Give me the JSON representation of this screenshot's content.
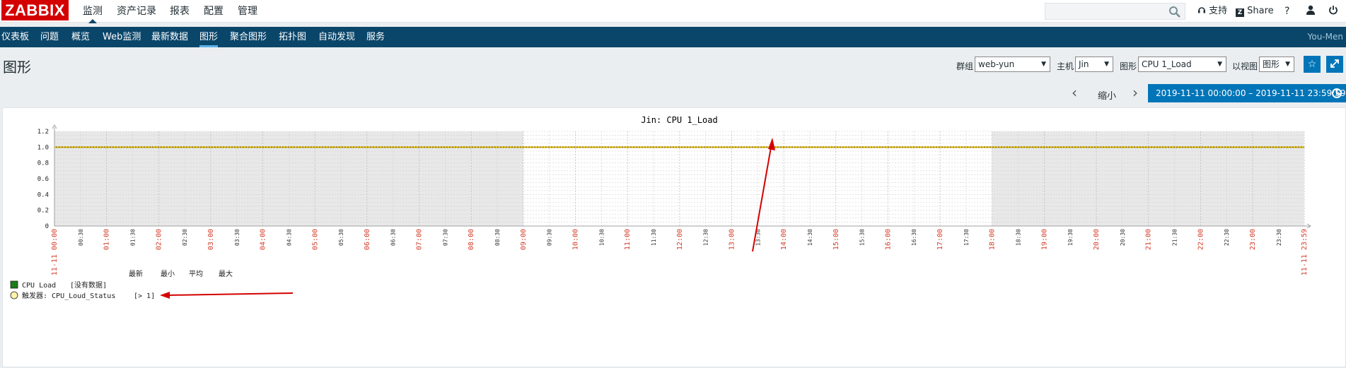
{
  "app": {
    "logo_text": "ZABBIX",
    "top_menu": [
      {
        "label": "监测",
        "active": true
      },
      {
        "label": "资产记录",
        "active": false
      },
      {
        "label": "报表",
        "active": false
      },
      {
        "label": "配置",
        "active": false
      },
      {
        "label": "管理",
        "active": false
      }
    ],
    "support_label": "支持",
    "share_label": "Share",
    "help_label": "?",
    "username": "You-Men"
  },
  "nav": {
    "items": [
      {
        "label": "仪表板",
        "active": false
      },
      {
        "label": "问题",
        "active": false
      },
      {
        "label": "概览",
        "active": false
      },
      {
        "label": "Web监测",
        "active": false
      },
      {
        "label": "最新数据",
        "active": false
      },
      {
        "label": "图形",
        "active": true
      },
      {
        "label": "聚合图形",
        "active": false
      },
      {
        "label": "拓扑图",
        "active": false
      },
      {
        "label": "自动发现",
        "active": false
      },
      {
        "label": "服务",
        "active": false
      }
    ]
  },
  "page": {
    "title": "图形",
    "filters": {
      "group_label": "群组",
      "group_value": "web-yun",
      "host_label": "主机",
      "host_value": "Jin",
      "graph_label": "图形",
      "graph_value": "CPU 1_Load",
      "view_label": "以视图",
      "view_value": "图形"
    },
    "time": {
      "zoom_out": "缩小",
      "range": "2019-11-11 00:00:00 – 2019-11-11 23:59:59"
    }
  },
  "chart_data": {
    "type": "line",
    "title": "Jin: CPU 1_Load",
    "ylim": [
      0,
      1.2
    ],
    "y_ticks": [
      "0",
      "0.2",
      "0.4",
      "0.6",
      "0.8",
      "1.0",
      "1.2"
    ],
    "x_tick_labels": [
      "11-11 00:00",
      "00:30",
      "01:00",
      "01:30",
      "02:00",
      "02:30",
      "03:00",
      "03:30",
      "04:00",
      "04:30",
      "05:00",
      "05:30",
      "06:00",
      "06:30",
      "07:00",
      "07:30",
      "08:00",
      "08:30",
      "09:00",
      "09:30",
      "10:00",
      "10:30",
      "11:00",
      "11:30",
      "12:00",
      "12:30",
      "13:00",
      "13:30",
      "14:00",
      "14:30",
      "15:00",
      "15:30",
      "16:00",
      "16:30",
      "17:00",
      "17:30",
      "18:00",
      "18:30",
      "19:00",
      "19:30",
      "20:00",
      "20:30",
      "21:00",
      "21:30",
      "22:00",
      "22:30",
      "23:00",
      "23:30",
      "11-11 23:59"
    ],
    "grid": true,
    "shaded_periods": [
      [
        "00:00",
        "09:00"
      ],
      [
        "18:00",
        "23:59"
      ]
    ],
    "series": [
      {
        "name": "CPU Load",
        "values": [],
        "color": "#1a7c1a"
      }
    ],
    "trigger": {
      "name": "CPU_Loud_Status",
      "threshold": 1,
      "color": "#e0c000"
    },
    "legend": {
      "headers": [
        "最新",
        "最小",
        "平均",
        "最大"
      ],
      "series_row": {
        "label": "CPU Load",
        "status": "[没有数据]"
      },
      "trigger_row": {
        "label": "触发器: CPU_Loud_Status",
        "condition": "[> 1]"
      }
    }
  }
}
